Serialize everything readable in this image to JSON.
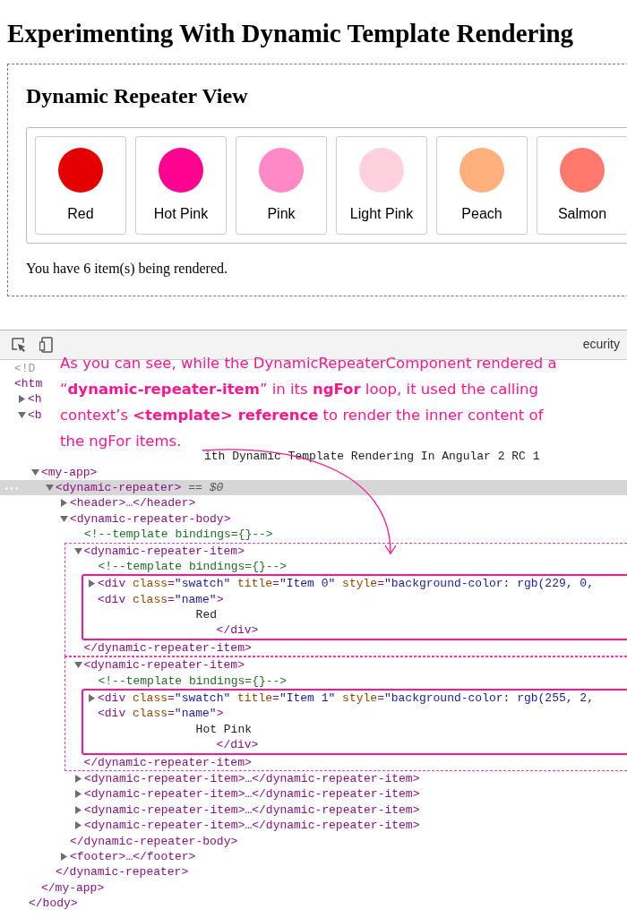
{
  "page": {
    "title": "Experimenting With Dynamic Template Rendering",
    "panel_title": "Dynamic Repeater View",
    "items": [
      {
        "name": "Red",
        "color": "#e50000"
      },
      {
        "name": "Hot Pink",
        "color": "#ff0290"
      },
      {
        "name": "Pink",
        "color": "#ff88c6"
      },
      {
        "name": "Light Pink",
        "color": "#ffd1df"
      },
      {
        "name": "Peach",
        "color": "#ffb07c"
      },
      {
        "name": "Salmon",
        "color": "#ff796c"
      }
    ],
    "summary": "You have 6 item(s) being rendered."
  },
  "devtools": {
    "tabs": [
      {
        "label": "ecurity",
        "selected": false
      }
    ],
    "note": "As you can see, while the DynamicRepeaterComponent rendered a “**dynamic-repeater-item**” in its **ngFor** loop, it used the calling context’s **<template> reference** to render the inner content of the ngFor items.",
    "covered_lines": [
      {
        "kind": "doctype",
        "text": "<!D"
      },
      {
        "kind": "tag",
        "text": "<htm"
      },
      {
        "kind": "tag",
        "text": "<h",
        "expanded": false
      },
      {
        "kind": "tag",
        "text": "<b",
        "expanded": true
      },
      {
        "kind": "text",
        "text": "ith Dynamic Template Rendering In Angular 2 RC 1"
      }
    ],
    "dom_tree": [
      {
        "tokens": [
          {
            "kind": "tag",
            "text": "<my-app>"
          }
        ],
        "expanded": true,
        "selected": false,
        "close": "</my-app>",
        "children": [
          {
            "tokens": [
              {
                "kind": "tag",
                "text": "<dynamic-repeater>"
              },
              {
                "kind": "ref",
                "text": " == $0"
              }
            ],
            "expanded": true,
            "selected": true,
            "close": "</dynamic-repeater>",
            "children": [
              {
                "tokens": [
                  {
                    "kind": "tag",
                    "text": "<header>…</header>"
                  }
                ],
                "expanded": false,
                "selected": false
              },
              {
                "tokens": [
                  {
                    "kind": "tag",
                    "text": "<dynamic-repeater-body>"
                  }
                ],
                "expanded": true,
                "selected": false,
                "close": "</dynamic-repeater-body>",
                "children": [
                  {
                    "tokens": [
                      {
                        "kind": "comment",
                        "text": "<!--template bindings={}-->"
                      }
                    ],
                    "selected": false
                  },
                  {
                    "outlined": true,
                    "tokens": [
                      {
                        "kind": "tag",
                        "text": "<dynamic-repeater-item>"
                      }
                    ],
                    "expanded": true,
                    "selected": false,
                    "close": "</dynamic-repeater-item>",
                    "children": [
                      {
                        "tokens": [
                          {
                            "kind": "comment",
                            "text": "<!--template bindings={}-->"
                          }
                        ],
                        "selected": false
                      },
                      {
                        "kind": "highlight",
                        "children": [
                          {
                            "tokens": [
                              {
                                "kind": "tag",
                                "text": "<div"
                              },
                              {
                                "kind": "attr",
                                "text": " class"
                              },
                              {
                                "kind": "tag",
                                "text": "="
                              },
                              {
                                "kind": "value",
                                "text": "\"swatch\""
                              },
                              {
                                "kind": "attr",
                                "text": " title"
                              },
                              {
                                "kind": "tag",
                                "text": "="
                              },
                              {
                                "kind": "value",
                                "text": "\"Item 0\""
                              },
                              {
                                "kind": "attr",
                                "text": " style"
                              },
                              {
                                "kind": "tag",
                                "text": "="
                              },
                              {
                                "kind": "value",
                                "text": "\"background-color: rgb(229, 0,"
                              }
                            ],
                            "expanded": false,
                            "selected": false
                          },
                          {
                            "tokens": [
                              {
                                "kind": "tag",
                                "text": "<div"
                              },
                              {
                                "kind": "attr",
                                "text": " class"
                              },
                              {
                                "kind": "tag",
                                "text": "="
                              },
                              {
                                "kind": "value",
                                "text": "\"name\""
                              },
                              {
                                "kind": "tag",
                                "text": ">"
                              }
                            ],
                            "selected": false,
                            "close": "</div>",
                            "children": [
                              {
                                "tokens": [
                                  {
                                    "kind": "text",
                                    "text": "Red"
                                  }
                                ],
                                "selected": false
                              }
                            ]
                          }
                        ]
                      }
                    ]
                  },
                  {
                    "outlined": true,
                    "tokens": [
                      {
                        "kind": "tag",
                        "text": "<dynamic-repeater-item>"
                      }
                    ],
                    "expanded": true,
                    "selected": false,
                    "close": "</dynamic-repeater-item>",
                    "children": [
                      {
                        "tokens": [
                          {
                            "kind": "comment",
                            "text": "<!--template bindings={}-->"
                          }
                        ],
                        "selected": false
                      },
                      {
                        "kind": "highlight",
                        "children": [
                          {
                            "tokens": [
                              {
                                "kind": "tag",
                                "text": "<div"
                              },
                              {
                                "kind": "attr",
                                "text": " class"
                              },
                              {
                                "kind": "tag",
                                "text": "="
                              },
                              {
                                "kind": "value",
                                "text": "\"swatch\""
                              },
                              {
                                "kind": "attr",
                                "text": " title"
                              },
                              {
                                "kind": "tag",
                                "text": "="
                              },
                              {
                                "kind": "value",
                                "text": "\"Item 1\""
                              },
                              {
                                "kind": "attr",
                                "text": " style"
                              },
                              {
                                "kind": "tag",
                                "text": "="
                              },
                              {
                                "kind": "value",
                                "text": "\"background-color: rgb(255, 2,"
                              }
                            ],
                            "expanded": false,
                            "selected": false
                          },
                          {
                            "tokens": [
                              {
                                "kind": "tag",
                                "text": "<div"
                              },
                              {
                                "kind": "attr",
                                "text": " class"
                              },
                              {
                                "kind": "tag",
                                "text": "="
                              },
                              {
                                "kind": "value",
                                "text": "\"name\""
                              },
                              {
                                "kind": "tag",
                                "text": ">"
                              }
                            ],
                            "selected": false,
                            "close": "</div>",
                            "children": [
                              {
                                "tokens": [
                                  {
                                    "kind": "text",
                                    "text": "Hot Pink"
                                  }
                                ],
                                "selected": false
                              }
                            ]
                          }
                        ]
                      }
                    ]
                  },
                  {
                    "tokens": [
                      {
                        "kind": "tag",
                        "text": "<dynamic-repeater-item>…</dynamic-repeater-item>"
                      }
                    ],
                    "expanded": false,
                    "selected": false
                  },
                  {
                    "tokens": [
                      {
                        "kind": "tag",
                        "text": "<dynamic-repeater-item>…</dynamic-repeater-item>"
                      }
                    ],
                    "expanded": false,
                    "selected": false
                  },
                  {
                    "tokens": [
                      {
                        "kind": "tag",
                        "text": "<dynamic-repeater-item>…</dynamic-repeater-item>"
                      }
                    ],
                    "expanded": false,
                    "selected": false
                  },
                  {
                    "tokens": [
                      {
                        "kind": "tag",
                        "text": "<dynamic-repeater-item>…</dynamic-repeater-item>"
                      }
                    ],
                    "expanded": false,
                    "selected": false
                  }
                ]
              },
              {
                "tokens": [
                  {
                    "kind": "tag",
                    "text": "<footer>…</footer>"
                  }
                ],
                "expanded": false,
                "selected": false
              }
            ]
          }
        ]
      }
    ],
    "trailing_lines": [
      "</body>"
    ]
  }
}
